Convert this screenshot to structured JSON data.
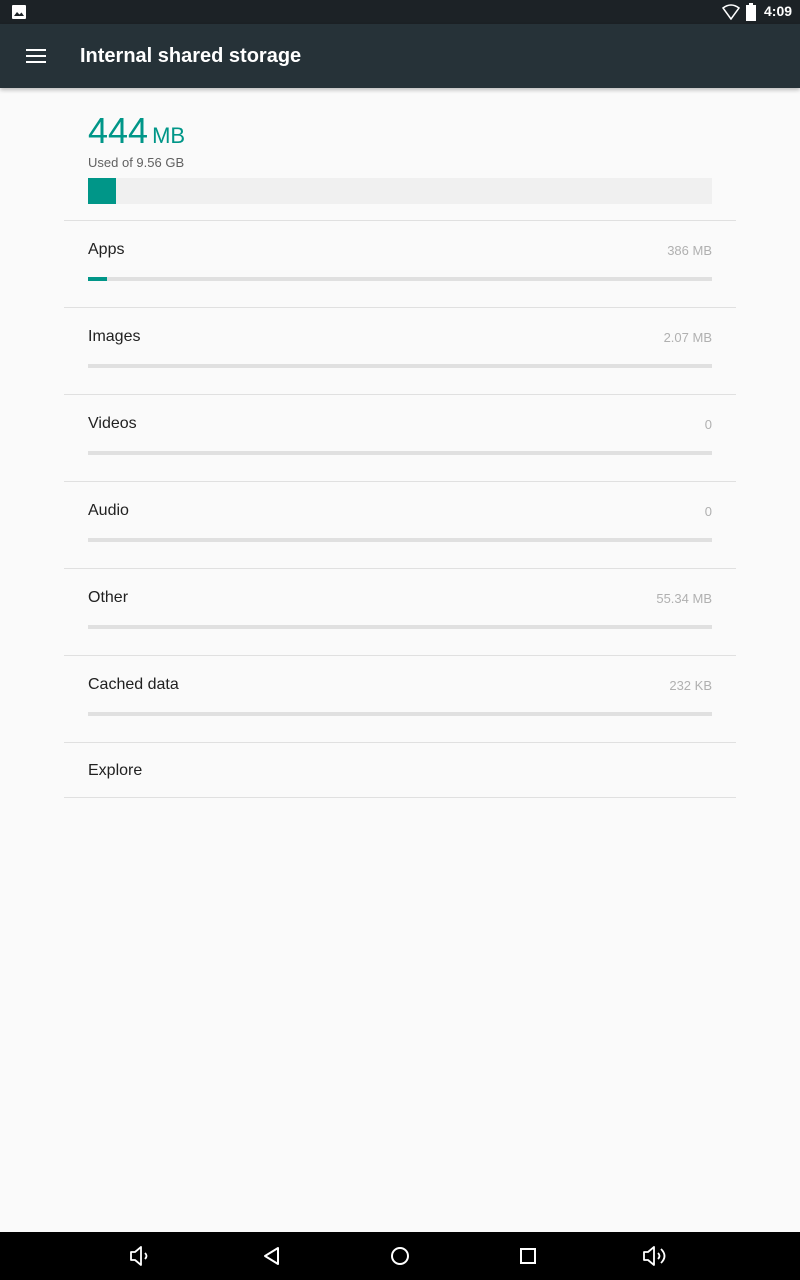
{
  "status_bar": {
    "time": "4:09",
    "icons": [
      "gallery-icon",
      "wifi-icon",
      "battery-icon"
    ]
  },
  "app_bar": {
    "title": "Internal shared storage",
    "menu_icon": "menu-icon"
  },
  "summary": {
    "used_number": "444",
    "used_unit": "MB",
    "used_of": "Used of 9.56 GB",
    "used_fraction": 0.045,
    "accent_color": "#009688"
  },
  "categories": [
    {
      "label": "Apps",
      "size": "386 MB",
      "fraction": 0.03
    },
    {
      "label": "Images",
      "size": "2.07 MB",
      "fraction": 0.0
    },
    {
      "label": "Videos",
      "size": "0",
      "fraction": 0.0
    },
    {
      "label": "Audio",
      "size": "0",
      "fraction": 0.0
    },
    {
      "label": "Other",
      "size": "55.34 MB",
      "fraction": 0.0
    },
    {
      "label": "Cached data",
      "size": "232 KB",
      "fraction": 0.0
    }
  ],
  "explore": {
    "label": "Explore"
  },
  "nav_bar": {
    "icons": [
      "volume-down-icon",
      "back-icon",
      "home-icon",
      "recents-icon",
      "volume-up-icon"
    ]
  }
}
